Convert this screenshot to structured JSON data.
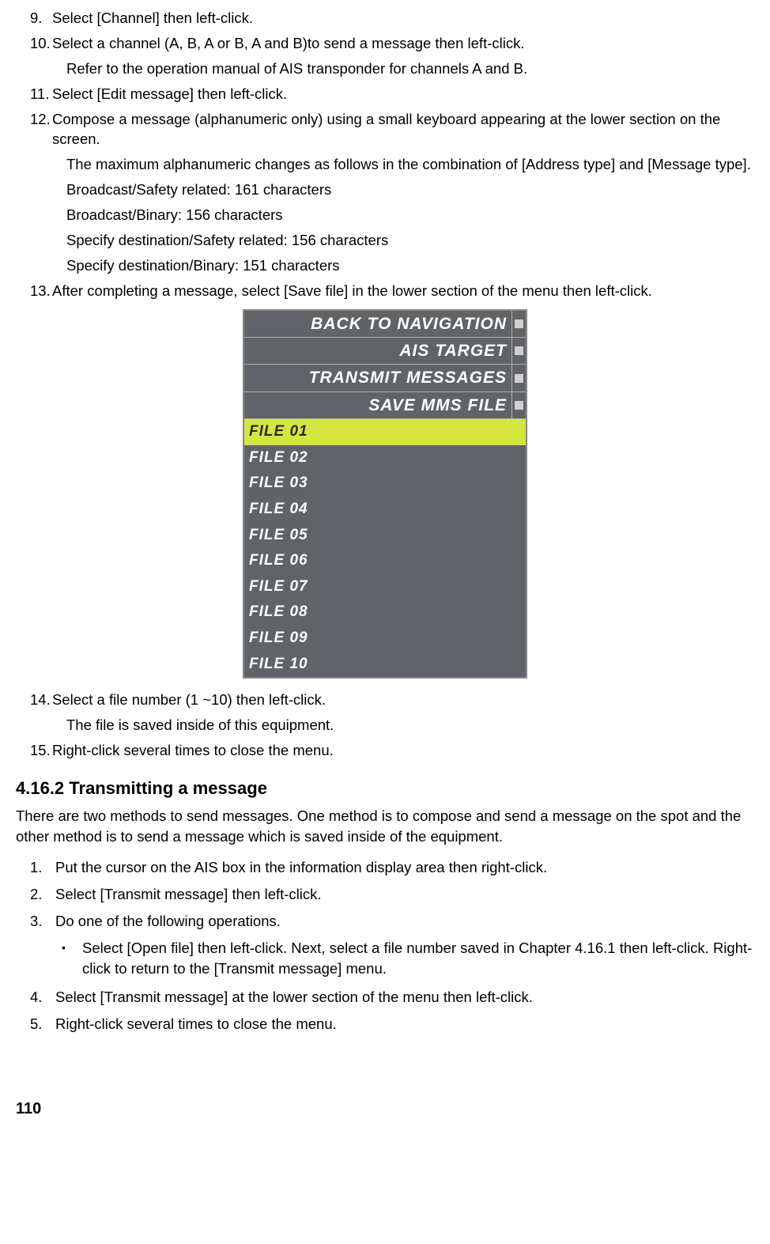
{
  "steps_first": {
    "s9_num": "9.",
    "s9_text": "Select [Channel] then left-click.",
    "s10_num": "10.",
    "s10_text": "Select a channel (A, B, A or B, A and B)to send a message then left-click.",
    "s10_sub": "Refer to the operation manual of AIS transponder for channels A and B.",
    "s11_num": "11.",
    "s11_text": "Select [Edit message] then left-click.",
    "s12_num": "12.",
    "s12_text": "Compose a message (alphanumeric only) using a small keyboard appearing at the lower section on the screen.",
    "s12_sub1": "The maximum alphanumeric changes as follows in the combination of [Address type] and [Message type].",
    "s12_sub2": "Broadcast/Safety related: 161 characters",
    "s12_sub3": "Broadcast/Binary: 156 characters",
    "s12_sub4": "Specify destination/Safety related: 156 characters",
    "s12_sub5": "Specify destination/Binary: 151 characters",
    "s13_num": "13.",
    "s13_text": "After completing a message, select [Save file] in the lower section of the menu then left-click.",
    "s14_num": "14.",
    "s14_text": "Select a file number (1 ~10) then left-click.",
    "s14_sub": "The file is saved inside of this equipment.",
    "s15_num": "15.",
    "s15_text": "Right-click several times to close the menu."
  },
  "menu": {
    "top": {
      "r1": "BACK TO NAVIGATION",
      "r2": "AIS TARGET",
      "r3": "TRANSMIT MESSAGES",
      "r4": "SAVE MMS FILE"
    },
    "files": {
      "f1": "FILE 01",
      "f2": "FILE 02",
      "f3": "FILE 03",
      "f4": "FILE 04",
      "f5": "FILE 05",
      "f6": "FILE 06",
      "f7": "FILE 07",
      "f8": "FILE 08",
      "f9": "FILE 09",
      "f10": "FILE 10"
    }
  },
  "section": {
    "heading": "4.16.2 Transmitting a message",
    "intro": "There are two methods to send messages. One method is to compose and send a message on the spot and the other method is to send a message which is saved inside of the equipment."
  },
  "steps_second": {
    "s1_num": "1.",
    "s1_text": "Put the cursor on the AIS box in the information display area then right-click.",
    "s2_num": "2.",
    "s2_text": "Select [Transmit message] then left-click.",
    "s3_num": "3.",
    "s3_text": "Do one of the following operations.",
    "bullet_dot": "•",
    "bullet_text": "Select [Open file] then left-click. Next, select a file number saved in Chapter 4.16.1 then left-click. Right-click to return to the [Transmit message] menu.",
    "s4_num": "4.",
    "s4_text": "Select [Transmit message] at the lower section of the menu then left-click.",
    "s5_num": "5.",
    "s5_text": "Right-click several times to close the menu."
  },
  "page_number": "110"
}
